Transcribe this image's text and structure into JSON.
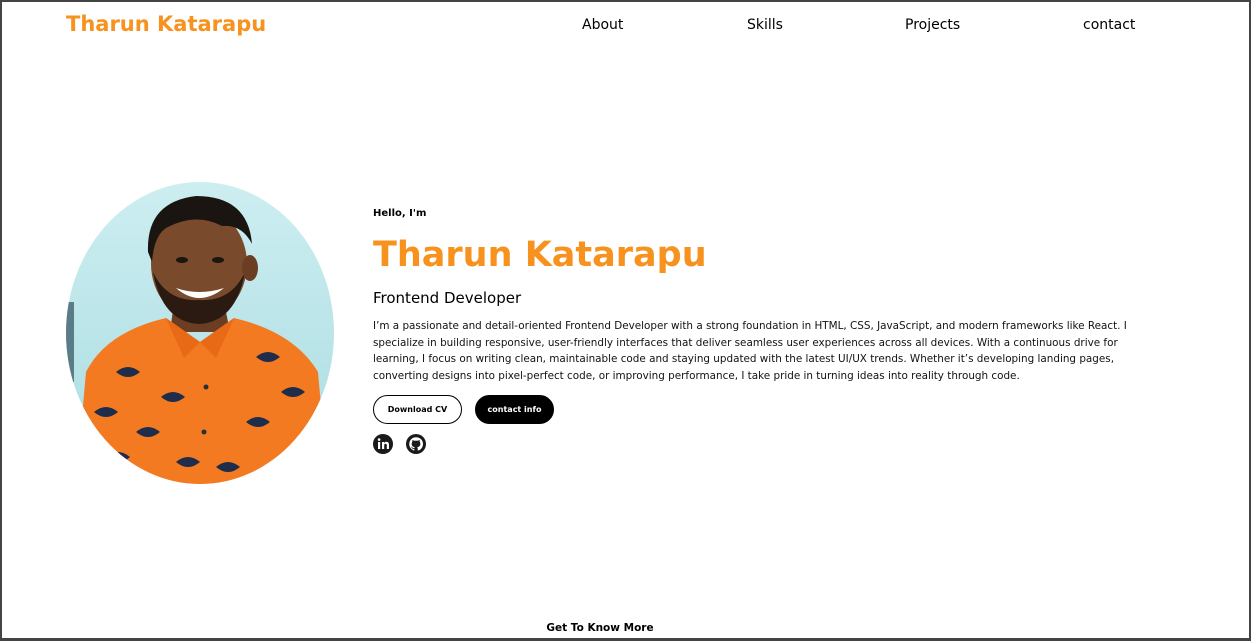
{
  "nav": {
    "logo": "Tharun Katarapu",
    "links": [
      "About",
      "Skills",
      "Projects",
      "contact"
    ]
  },
  "hero": {
    "greeting": "Hello, I'm",
    "name": "Tharun Katarapu",
    "role": "Frontend Developer",
    "bio": "I’m a passionate and detail-oriented Frontend Developer with a strong foundation in HTML, CSS, JavaScript, and modern frameworks like React. I specialize in building responsive, user-friendly interfaces that deliver seamless user experiences across all devices. With a continuous drive for learning, I focus on writing clean, maintainable code and staying updated with the latest UI/UX trends. Whether it’s developing landing pages, converting designs into pixel-perfect code, or improving performance, I take pride in turning ideas into reality through code.",
    "buttons": {
      "download": "Download CV",
      "contact": "contact info"
    },
    "socials": [
      "linkedin-icon",
      "github-icon"
    ]
  },
  "footer": {
    "more": "Get To Know More"
  },
  "colors": {
    "accent": "#f7921e",
    "text": "#000000",
    "background": "#ffffff"
  }
}
